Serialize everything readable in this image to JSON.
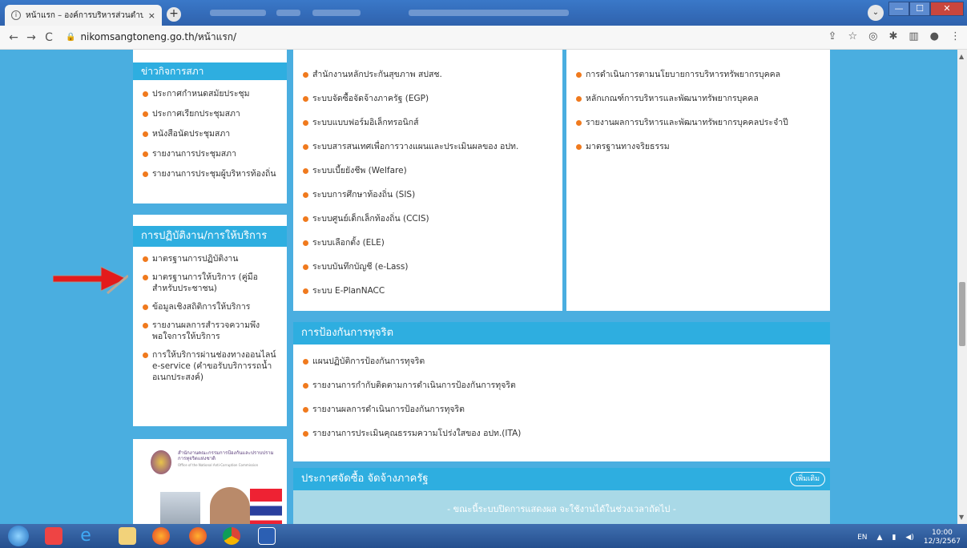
{
  "browser": {
    "tab_title": "หน้าแรก – องค์การบริหารส่วนตำบล",
    "tab_close": "×",
    "new_tab": "+",
    "url": "nikomsangtoneng.go.th/หน้าแรก/",
    "back": "←",
    "forward": "→",
    "reload": "C",
    "lock": "🔒",
    "minimize": "—",
    "maximize": "☐",
    "close": "✕",
    "tab_search": "⌄"
  },
  "sidebar": {
    "council_news": {
      "heading": "ข่าวกิจการสภา",
      "items": [
        "ประกาศกำหนดสมัยประชุม",
        "ประกาศเรียกประชุมสภา",
        "หนังสือนัดประชุมสภา",
        "รายงานการประชุมสภา",
        "รายงานการประชุมผู้บริหารท้องถิ่น"
      ]
    },
    "services": {
      "heading": "การปฏิบัติงาน/การให้บริการ",
      "items": [
        "มาตรฐานการปฏิบัติงาน",
        "มาตรฐานการให้บริการ (คู่มือสำหรับประชาชน)",
        "ข้อมูลเชิงสถิติการให้บริการ",
        "รายงานผลการสำรวจความพึงพอใจการให้บริการ",
        "การให้บริการผ่านช่องทางออนไลน์ e-service (คำขอรับบริการรถน้ำอเนกประสงค์)"
      ]
    },
    "banner": {
      "org_name": "สำนักงานคณะกรรมการป้องกันและปราบปรามการทุจริตแห่งชาติ",
      "org_name_en": "Office of the National Anti-Corruption Commission"
    }
  },
  "systems": {
    "items": [
      "สำนักงานหลักประกันสุขภาพ สปสช.",
      "ระบบจัดซื้อจัดจ้างภาครัฐ (EGP)",
      "ระบบแบบฟอร์มอิเล็กทรอนิกส์",
      "ระบบสารสนเทศเพื่อการวางแผนและประเมินผลของ อปท.",
      "ระบบเบี้ยยังชีพ (Welfare)",
      "ระบบการศึกษาท้องถิ่น (SIS)",
      "ระบบศูนย์เด็กเล็กท้องถิ่น (CCIS)",
      "ระบบเลือกตั้ง (ELE)",
      "ระบบบันทึกบัญชี (e-Lass)",
      "ระบบ E-PlanNACC"
    ]
  },
  "hr": {
    "items": [
      "การดำเนินการตามนโยบายการบริหารทรัพยากรบุคคล",
      "หลักเกณฑ์การบริหารและพัฒนาทรัพยากรบุคคล",
      "รายงานผลการบริหารและพัฒนาทรัพยากรบุคคลประจำปี",
      "มาตรฐานทางจริยธรรม"
    ]
  },
  "anticorruption": {
    "heading": "การป้องกันการทุจริต",
    "items": [
      "แผนปฏิบัติการป้องกันการทุจริต",
      "รายงานการกำกับติดตามการดำเนินการป้องกันการทุจริต",
      "รายงานผลการดำเนินการป้องกันการทุจริต",
      "รายงานการประเมินคุณธรรมความโปร่งใสของ อปท.(ITA)"
    ]
  },
  "procurement": {
    "heading": "ประกาศจัดซื้อ จัดจ้างภาครัฐ",
    "more": "เพิ่มเติม",
    "notice": "- ขณะนี้ระบบปิดการแสดงผล จะใช้งานได้ในช่วงเวลาถัดไป -"
  },
  "taskbar": {
    "lang": "EN",
    "time": "10:00",
    "date": "12/3/2567"
  },
  "colors": {
    "page_bg": "#4aaee0",
    "header_blue": "#2eaee0",
    "bullet_orange": "#f07a1e",
    "arrow_red": "#e31b1b"
  }
}
